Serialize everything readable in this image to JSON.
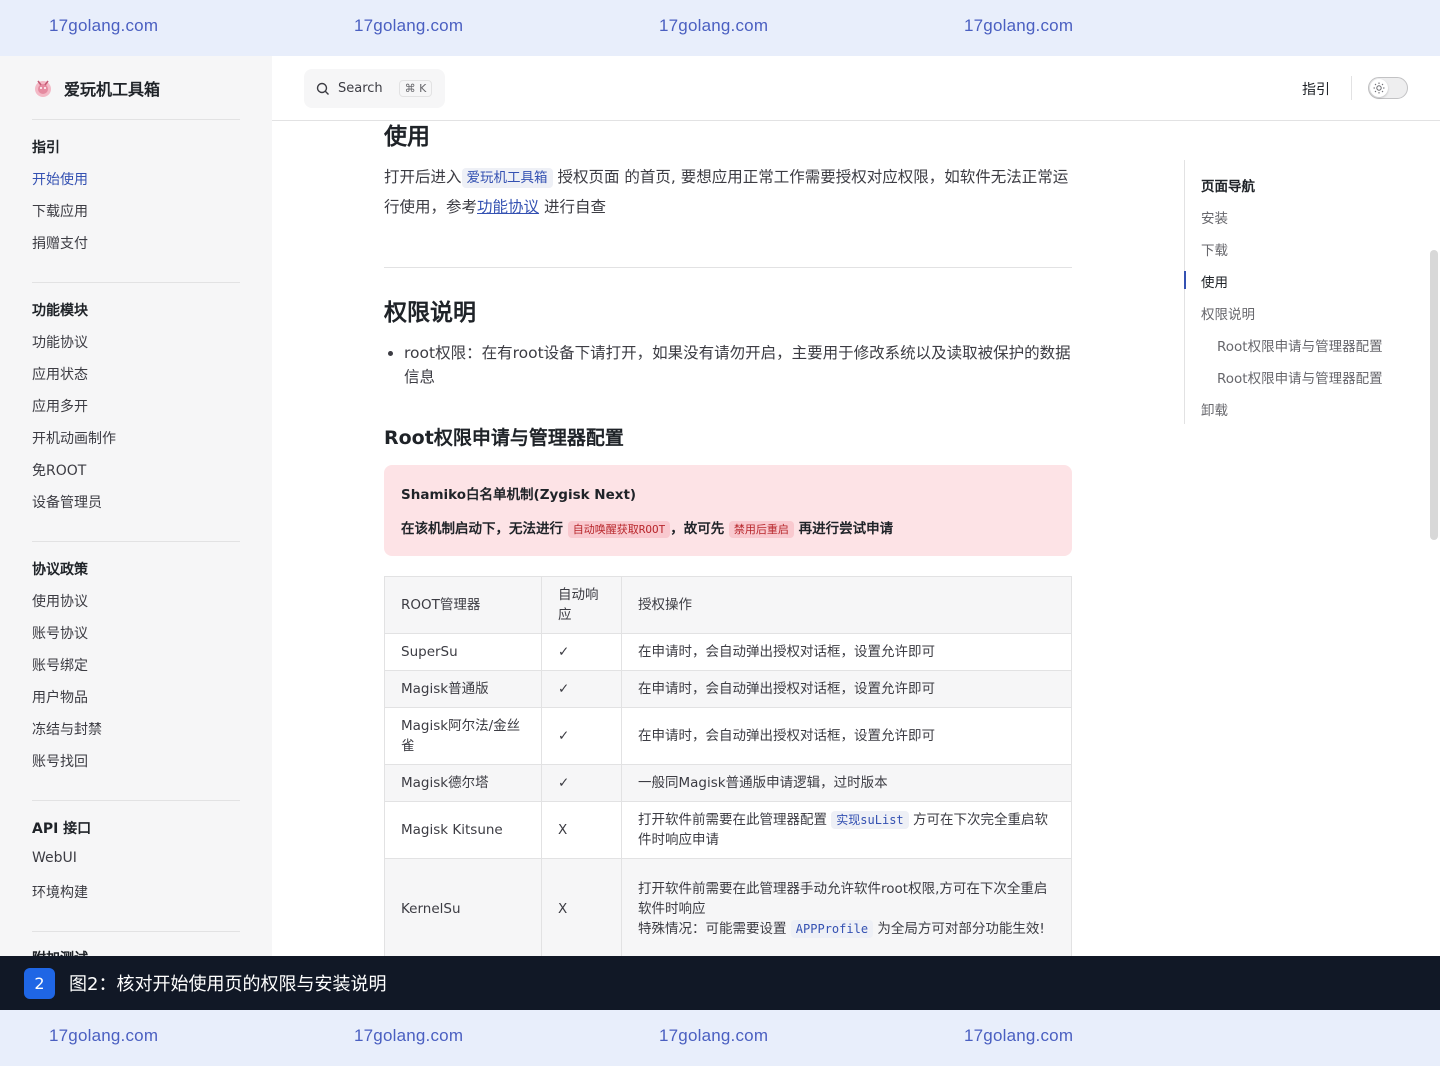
{
  "watermark": {
    "text": "17golang.com"
  },
  "sidebar": {
    "title": "爱玩机工具箱",
    "groups": [
      {
        "heading": "指引",
        "items": [
          "开始使用",
          "下载应用",
          "捐赠支付"
        ]
      },
      {
        "heading": "功能模块",
        "items": [
          "功能协议",
          "应用状态",
          "应用多开",
          "开机动画制作",
          "免ROOT",
          "设备管理员"
        ]
      },
      {
        "heading": "协议政策",
        "items": [
          "使用协议",
          "账号协议",
          "账号绑定",
          "用户物品",
          "冻结与封禁",
          "账号找回"
        ]
      },
      {
        "heading": "API 接口",
        "items": [
          "WebUI",
          "环境构建"
        ]
      },
      {
        "heading": "附加测试",
        "items": []
      }
    ],
    "active_item": "开始使用"
  },
  "topbar": {
    "search_label": "Search",
    "search_kbd": "⌘ K",
    "nav_link": "指引"
  },
  "content": {
    "h_use": "使用",
    "p_use": {
      "pre": "打开后进入",
      "code": "爱玩机工具箱",
      "mid": "授权页面 的首页, 要想应用正常工作需要授权对应权限，如软件无法正常运行使用，参考",
      "link": "功能协议",
      "post": "进行自查"
    },
    "h_perm": "权限说明",
    "bullet_root": "root权限：在有root设备下请打开，如果没有请勿开启，主要用于修改系统以及读取被保护的数据信息",
    "h_root_cfg": "Root权限申请与管理器配置",
    "danger": {
      "title": "Shamiko白名单机制(Zygisk Next)",
      "pre": "在该机制启动下，无法进行",
      "code1": "自动唤醒获取ROOT",
      "mid": "，故可先",
      "code2": "禁用后重启",
      "post": "再进行尝试申请"
    },
    "table": {
      "headers": [
        "ROOT管理器",
        "自动响应",
        "授权操作"
      ],
      "rows": [
        {
          "manager": "SuperSu",
          "auto": "✓",
          "action": "在申请时，会自动弹出授权对话框，设置允许即可"
        },
        {
          "manager": "Magisk普通版",
          "auto": "✓",
          "action": "在申请时，会自动弹出授权对话框，设置允许即可"
        },
        {
          "manager": "Magisk阿尔法/金丝雀",
          "auto": "✓",
          "action": "在申请时，会自动弹出授权对话框，设置允许即可"
        },
        {
          "manager": "Magisk德尔塔",
          "auto": "✓",
          "action": "一般同Magisk普通版申请逻辑，过时版本"
        },
        {
          "manager": "Magisk Kitsune",
          "auto": "X",
          "action_pre": "打开软件前需要在此管理器配置",
          "action_code": "实现suList",
          "action_post": "方可在下次完全重启软件时响应申请"
        },
        {
          "manager": "KernelSu",
          "auto": "X",
          "action_l1": "打开软件前需要在此管理器手动允许软件root权限,方可在下次全重启软件时响应",
          "action_l2_pre": "特殊情况：可能需要设置",
          "action_l2_code": "APPProfile",
          "action_l2_post": "为全局方可对部分功能生效!"
        }
      ]
    }
  },
  "outline": {
    "title": "页面导航",
    "items": [
      "安装",
      "下载",
      "使用",
      "权限说明",
      "Root权限申请与管理器配置",
      "Root权限申请与管理器配置",
      "卸载"
    ],
    "active": "使用"
  },
  "caption": {
    "badge": "2",
    "text": "图2：核对开始使用页的权限与安装说明"
  }
}
